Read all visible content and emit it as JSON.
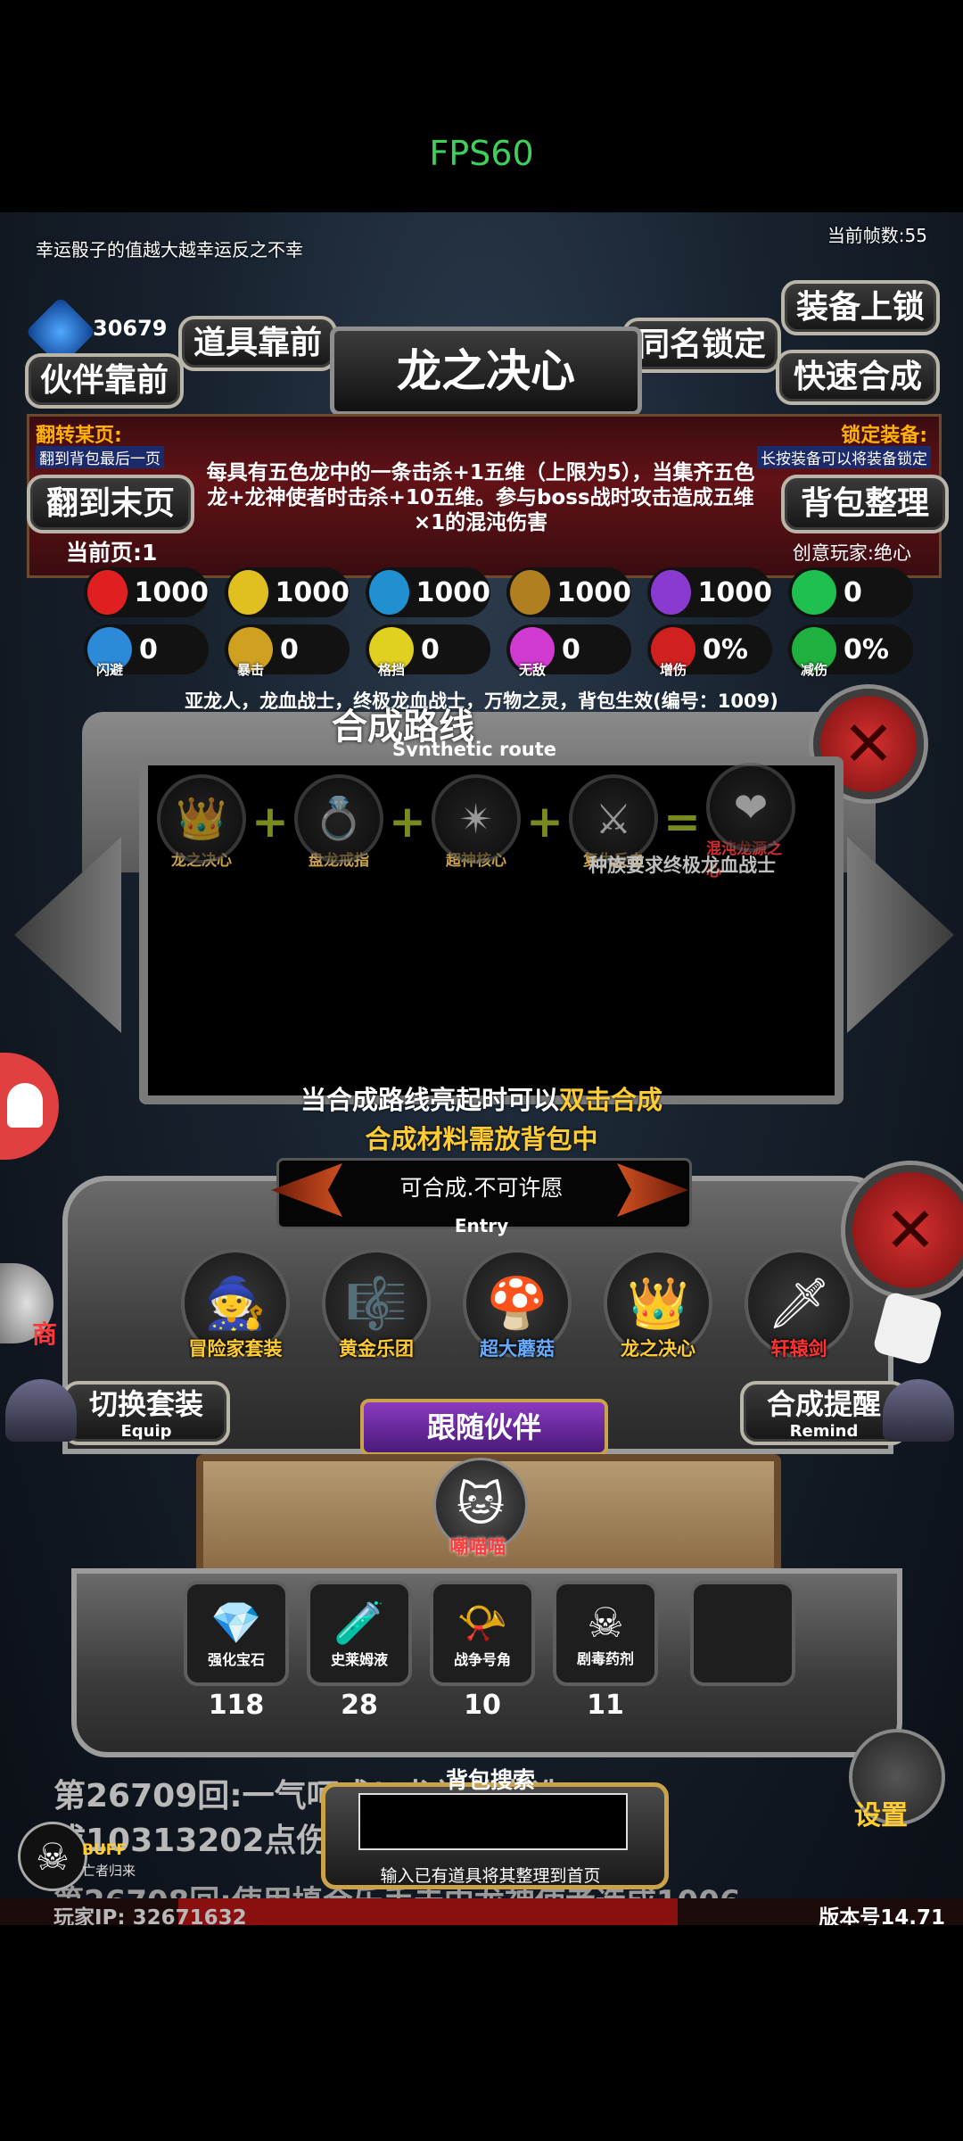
{
  "status_bar": {
    "fps": "FPS60"
  },
  "top": {
    "motto": "幸运骰子的值越大越幸运反之不幸",
    "frame_count": "当前帧数:55",
    "coins": "30679",
    "buttons": {
      "item_front": "道具靠前",
      "same_name_lock": "同名锁定",
      "equip_lock": "装备上锁",
      "partner_front": "伙伴靠前",
      "quick_craft": "快速合成",
      "flip_last": "翻到末页",
      "bag_sort": "背包整理"
    }
  },
  "item_panel": {
    "title": "龙之决心",
    "flip_page_label": "翻转某页:",
    "flip_page_hint": "翻到背包最后一页",
    "lock_equip_label": "锁定装备:",
    "lock_equip_hint": "长按装备可以将装备锁定",
    "description": "每具有五色龙中的一条击杀+1五维（上限为5），当集齐五色龙+龙神使者时击杀+10五维。参与boss战时攻击造成五维×1的混沌伤害",
    "current_page": "当前页:1",
    "creative_player": "创意玩家:绝心",
    "stats_row1": [
      {
        "icon": "heart-icon",
        "color": "#e02020",
        "value": "1000"
      },
      {
        "icon": "strength-icon",
        "color": "#e0c020",
        "value": "1000"
      },
      {
        "icon": "helmet-icon",
        "color": "#2090d0",
        "value": "1000"
      },
      {
        "icon": "sword-icon",
        "color": "#b08020",
        "value": "1000"
      },
      {
        "icon": "lightning-icon",
        "color": "#8a3ad0",
        "value": "1000"
      },
      {
        "icon": "clover-icon",
        "color": "#20c050",
        "value": "0"
      }
    ],
    "stats_row2": [
      {
        "icon": "dodge-icon",
        "color": "#2c8ad8",
        "value": "0",
        "label": "闪避"
      },
      {
        "icon": "crit-icon",
        "color": "#d0a020",
        "value": "0",
        "label": "暴击"
      },
      {
        "icon": "block-icon",
        "color": "#e0d020",
        "value": "0",
        "label": "格挡"
      },
      {
        "icon": "invincible-icon",
        "color": "#d03ad0",
        "value": "0",
        "label": "无敌"
      },
      {
        "icon": "damage-up-icon",
        "color": "#d02020",
        "value": "0%",
        "label": "增伤"
      },
      {
        "icon": "damage-down-icon",
        "color": "#20b040",
        "value": "0%",
        "label": "减伤"
      }
    ],
    "effect_line": "亚龙人，龙血战士，终极龙血战士，万物之灵，背包生效(编号：1009)"
  },
  "route_panel": {
    "title": "合成路线",
    "subtitle": "Synthetic route",
    "items": [
      {
        "name": "龙之决心",
        "icon": "flame-crown-icon"
      },
      {
        "name": "盘龙戒指",
        "icon": "ring-icon"
      },
      {
        "name": "超神核心",
        "icon": "core-icon"
      },
      {
        "name": "复仇反击",
        "icon": "warrior-icon"
      }
    ],
    "result": {
      "name": "混沌龙源之心",
      "icon": "dragon-heart-icon"
    },
    "requirement": "种族要求终极龙血战士",
    "hint_prefix": "当合成路线亮起时可以",
    "hint_highlight": "双击合成",
    "hint_line2": "合成材料需放背包中"
  },
  "entry_panel": {
    "status": "可合成.不可许愿",
    "entry_label": "Entry",
    "items": [
      {
        "name": "冒险家套装",
        "icon": "adventurer-icon",
        "color": "#ffcc33"
      },
      {
        "name": "黄金乐团",
        "icon": "harp-icon",
        "color": "#ffcc33"
      },
      {
        "name": "超大蘑菇",
        "icon": "mushroom-icon",
        "color": "#66aaff"
      },
      {
        "name": "龙之决心",
        "icon": "flame-crown-icon",
        "color": "#ffcc33"
      },
      {
        "name": "轩辕剑",
        "icon": "sword-icon",
        "color": "#ff3333"
      }
    ],
    "switch_equip": "切换套装",
    "switch_equip_en": "Equip",
    "craft_remind": "合成提醒",
    "craft_remind_en": "Remind",
    "follow_partner": "跟随伙伴",
    "partner_name": "嘲喵喵"
  },
  "consumables": [
    {
      "name": "强化宝石",
      "count": "118",
      "icon": "gem-icon"
    },
    {
      "name": "史莱姆液",
      "count": "28",
      "icon": "potion-icon"
    },
    {
      "name": "战争号角",
      "count": "10",
      "icon": "horn-icon"
    },
    {
      "name": "剧毒药剂",
      "count": "11",
      "icon": "poison-icon"
    }
  ],
  "bottom": {
    "log1": "第26709回:一气呵成！龙神使者造",
    "log2": "成10313202点伤害",
    "log3": "第26708回:使用填合乐手击中龙神使者造成1006",
    "bag_search_label": "背包搜索",
    "search_hint": "输入已有道具将其整理到首页",
    "settings": "设置",
    "buff_label": "BUFF",
    "buff_sub": "亡者归来",
    "player_ip": "玩家IP: 32671632",
    "version": "版本号14.71",
    "shop": "商"
  }
}
